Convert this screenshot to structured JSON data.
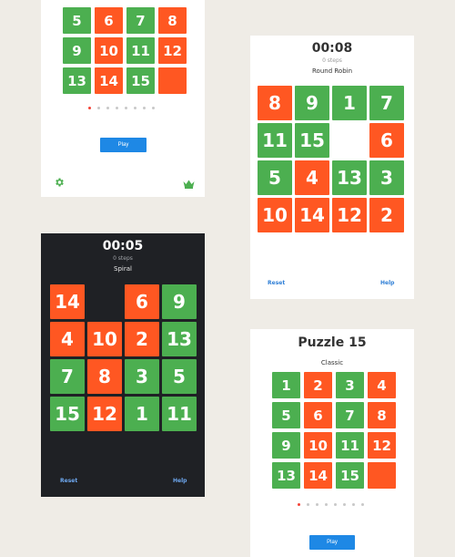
{
  "colors": {
    "background": "#efece6",
    "tile_green": "#4caf50",
    "tile_orange": "#ff5722",
    "accent_blue": "#1e88e5",
    "dark_card": "#1f2125"
  },
  "card_classic_top": {
    "tiles": [
      "5",
      "6",
      "7",
      "8",
      "9",
      "10",
      "11",
      "12",
      "13",
      "14",
      "15",
      ""
    ],
    "tile_colors": [
      "green",
      "orange",
      "green",
      "orange",
      "green",
      "orange",
      "green",
      "orange",
      "green",
      "orange",
      "green",
      "orange"
    ],
    "page_dots": 8,
    "active_dot": 0,
    "play_label": "Play",
    "settings_icon": "gear-icon",
    "leaderboard_icon": "crown-icon"
  },
  "card_round_robin": {
    "timer": "00:08",
    "steps": "0 steps",
    "mode": "Round Robin",
    "tiles": [
      "8",
      "9",
      "1",
      "7",
      "11",
      "15",
      "",
      "6",
      "5",
      "4",
      "13",
      "3",
      "10",
      "14",
      "12",
      "2"
    ],
    "tile_colors": [
      "orange",
      "green",
      "green",
      "green",
      "green",
      "green",
      "empty",
      "orange",
      "green",
      "orange",
      "green",
      "green",
      "orange",
      "orange",
      "orange",
      "orange"
    ],
    "reset_label": "Reset",
    "help_label": "Help"
  },
  "card_spiral": {
    "timer": "00:05",
    "steps": "0 steps",
    "mode": "Spiral",
    "tiles": [
      "14",
      "",
      "6",
      "9",
      "4",
      "10",
      "2",
      "13",
      "7",
      "8",
      "3",
      "5",
      "15",
      "12",
      "1",
      "11"
    ],
    "tile_colors": [
      "orange",
      "empty",
      "orange",
      "green",
      "orange",
      "orange",
      "orange",
      "green",
      "green",
      "orange",
      "green",
      "green",
      "green",
      "orange",
      "green",
      "green"
    ],
    "reset_label": "Reset",
    "help_label": "Help"
  },
  "card_classic_bottom": {
    "title": "Puzzle 15",
    "mode": "Classic",
    "tiles": [
      "1",
      "2",
      "3",
      "4",
      "5",
      "6",
      "7",
      "8",
      "9",
      "10",
      "11",
      "12",
      "13",
      "14",
      "15",
      ""
    ],
    "tile_colors": [
      "green",
      "orange",
      "green",
      "orange",
      "green",
      "orange",
      "green",
      "orange",
      "green",
      "orange",
      "green",
      "orange",
      "green",
      "orange",
      "green",
      "orange"
    ],
    "page_dots": 8,
    "active_dot": 0,
    "play_label": "Play"
  }
}
